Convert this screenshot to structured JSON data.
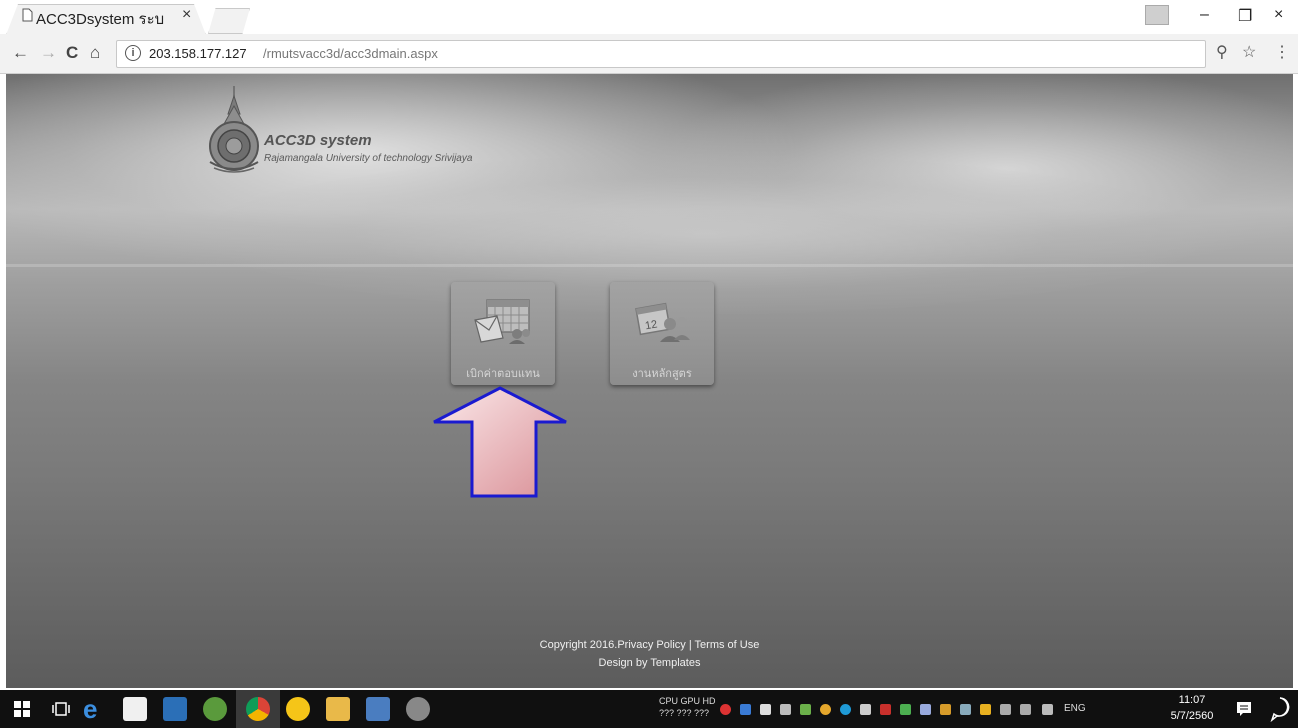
{
  "browser": {
    "tab_title": "ACC3Dsystem ระบ",
    "tab_close": "×",
    "url_host": "203.158.177.127",
    "url_path": "/rmutsvacc3d/acc3dmain.aspx",
    "info_glyph": "i",
    "nav": {
      "back": "←",
      "forward": "→",
      "reload": "C",
      "home": "⌂"
    },
    "toolbar_icons": {
      "extension": "⚲",
      "bookmark": "☆",
      "menu": "⋮"
    },
    "window_controls": {
      "minimize": "–",
      "restore": "❐",
      "close": "×"
    }
  },
  "page": {
    "brand_title": "ACC3D system",
    "brand_subtitle": "Rajamangala University of technology Srivijaya",
    "tiles": [
      {
        "label": "เบิกค่าตอบแทน",
        "icon": "calendar-envelope-icon"
      },
      {
        "label": "งานหลักสูตร",
        "icon": "calendar-people-icon"
      }
    ],
    "footer": {
      "copyright": "Copyright 2016.Privacy Policy | Terms of Use",
      "design": "Design by Templates"
    },
    "colors": {
      "arrow_fill": "#e8b8bc",
      "arrow_stroke": "#1a1ad0"
    }
  },
  "taskbar": {
    "sys_monitor_labels": "CPU GPU HD",
    "sys_monitor_values": "??? ??? ???",
    "language": "ENG",
    "time": "11:07",
    "date": "5/7/2560"
  }
}
